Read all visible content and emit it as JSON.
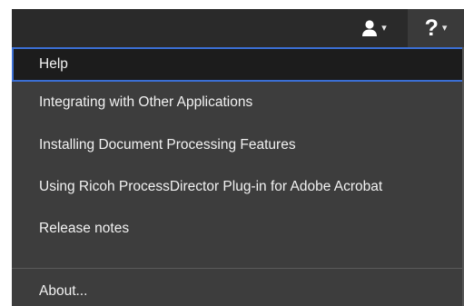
{
  "menu": {
    "items": [
      {
        "label": "Help",
        "active": true
      },
      {
        "label": "Integrating with Other Applications"
      },
      {
        "label": "Installing Document Processing Features"
      },
      {
        "label": "Using Ricoh ProcessDirector Plug-in for Adobe Acrobat"
      },
      {
        "label": "Release notes"
      },
      {
        "label": "About..."
      }
    ]
  },
  "toolbar": {
    "help_label": "?",
    "user_icon": "user-icon",
    "caret_icon": "caret-down-icon"
  },
  "colors": {
    "topbar": "#2a2a2a",
    "menu_bg": "#3d3d3d",
    "active_bg": "#1c1c1c",
    "active_border": "#3b6fd4"
  }
}
